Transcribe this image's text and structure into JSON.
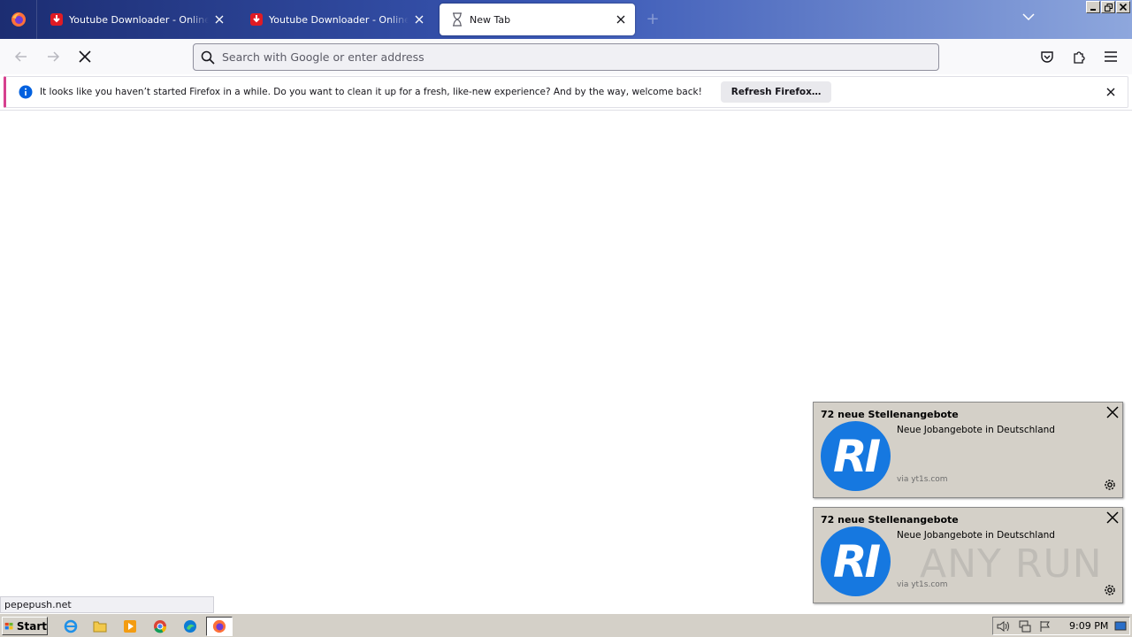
{
  "tabs": [
    {
      "title": "Youtube Downloader - Online Youtube Video Downloader",
      "active": false
    },
    {
      "title": "Youtube Downloader - Online Youtube Video Downloader",
      "active": false
    },
    {
      "title": "New Tab",
      "active": true
    }
  ],
  "urlbar": {
    "placeholder": "Search with Google or enter address",
    "value": ""
  },
  "notification": {
    "message": "It looks like you haven’t started Firefox in a while. Do you want to clean it up for a fresh, like-new experience? And by the way, welcome back!",
    "button_label": "Refresh Firefox…"
  },
  "status_link": "pepepush.net",
  "toasts": [
    {
      "title": "72 neue Stellenangebote",
      "logo_text": "RI",
      "body": "Neue Jobangebote in Deutschland",
      "via": "via yt1s.com"
    },
    {
      "title": "72 neue Stellenangebote",
      "logo_text": "RI",
      "body": "Neue Jobangebote in Deutschland",
      "via": "via yt1s.com"
    }
  ],
  "watermark": "ANY RUN",
  "taskbar": {
    "start_label": "Start",
    "clock": "9:09 PM"
  },
  "colors": {
    "accent": "#1678e0",
    "tab_favicon": "#e01b24",
    "notif_stripe": "#d7408f"
  }
}
